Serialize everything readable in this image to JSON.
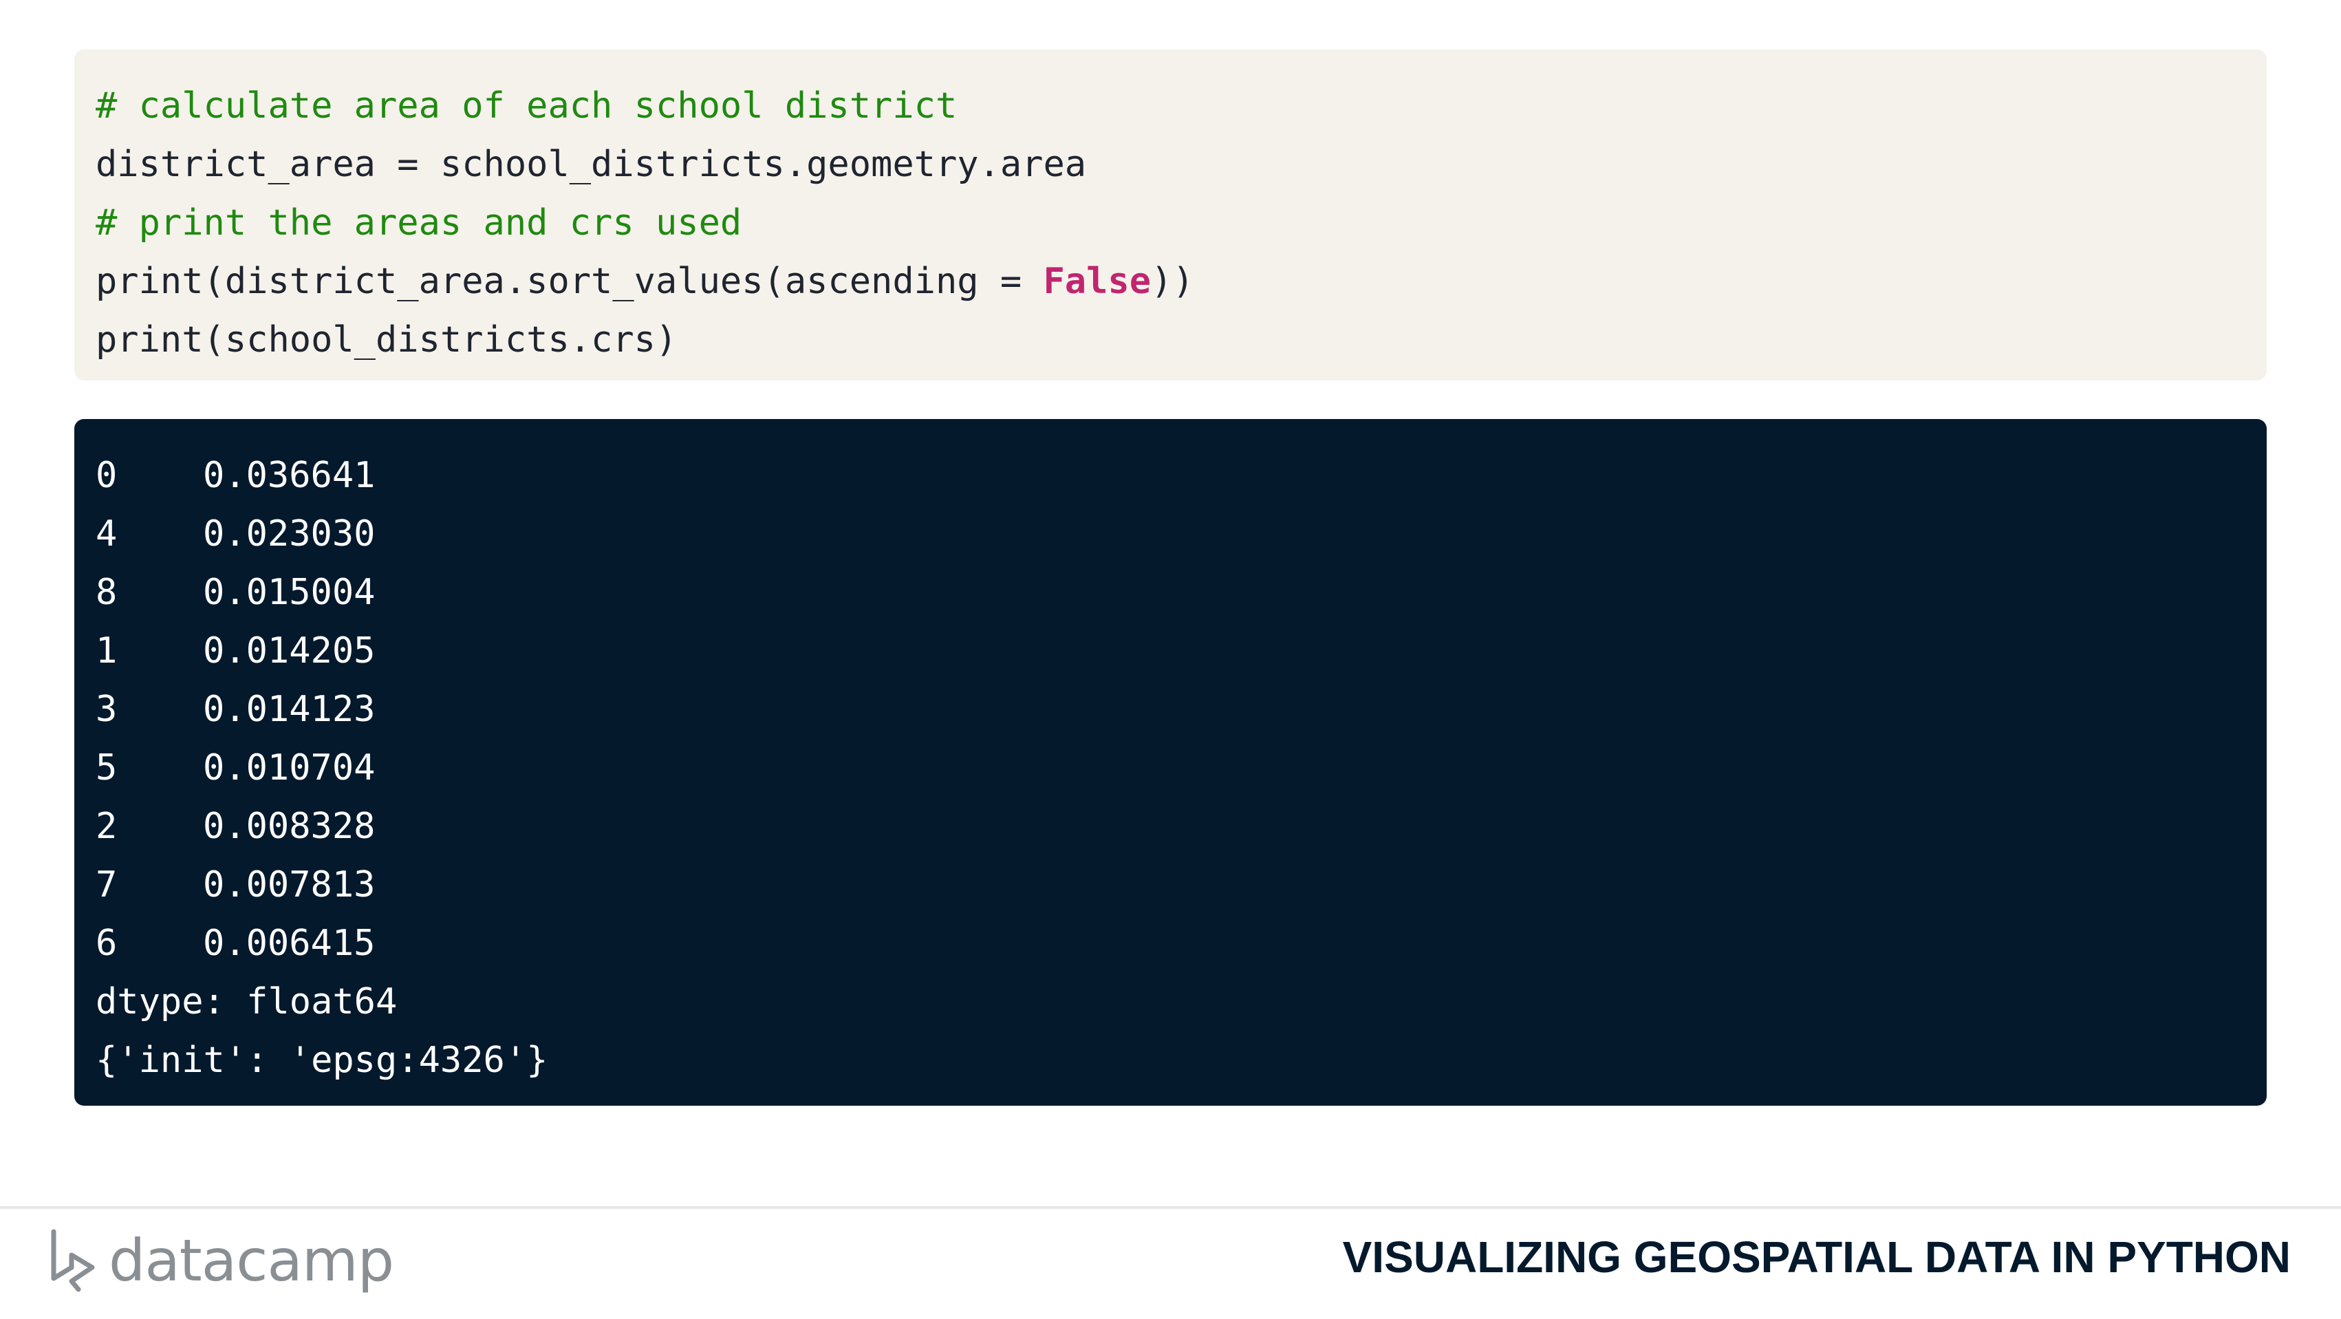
{
  "code": {
    "line1": "# calculate area of each school district",
    "line2": "district_area = school_districts.geometry.area",
    "line3": "# print the areas and crs used",
    "line4_pre": "print(district_area.sort_values(ascending = ",
    "line4_kw": "False",
    "line4_post": "))",
    "line5": "print(school_districts.crs)"
  },
  "output": {
    "rows": [
      {
        "index": "0",
        "value": "0.036641"
      },
      {
        "index": "4",
        "value": "0.023030"
      },
      {
        "index": "8",
        "value": "0.015004"
      },
      {
        "index": "1",
        "value": "0.014205"
      },
      {
        "index": "3",
        "value": "0.014123"
      },
      {
        "index": "5",
        "value": "0.010704"
      },
      {
        "index": "2",
        "value": "0.008328"
      },
      {
        "index": "7",
        "value": "0.007813"
      },
      {
        "index": "6",
        "value": "0.006415"
      }
    ],
    "dtype": "dtype: float64",
    "crs": "{'init': 'epsg:4326'}"
  },
  "footer": {
    "logo_text": "datacamp",
    "logo_icon": "datacamp-logo-icon",
    "course_title": "VISUALIZING GEOSPATIAL DATA IN PYTHON"
  },
  "colors": {
    "code_bg": "#f5f2eb",
    "output_bg": "#05192d",
    "comment": "#1f8a10",
    "keyword": "#c0266f"
  }
}
